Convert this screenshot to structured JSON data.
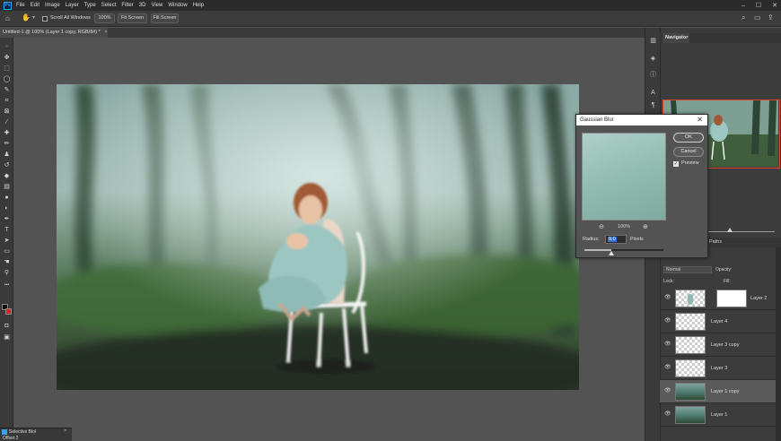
{
  "menu": {
    "items": [
      "File",
      "Edit",
      "Image",
      "Layer",
      "Type",
      "Select",
      "Filter",
      "3D",
      "View",
      "Window",
      "Help"
    ]
  },
  "options_bar": {
    "scroll_all_label": "Scroll All Windows",
    "zoom_value": "100%",
    "fit_screen_label": "Fit Screen",
    "fill_screen_label": "Fill Screen"
  },
  "document": {
    "tab_title": "Untitled-1 @ 100% (Layer 1 copy, RGB/8#) *"
  },
  "panels": {
    "navigator_tab": "Navigator",
    "layers_tab": "Paths",
    "blend_mode": "Normal",
    "opacity_label": "Opacity:",
    "lock_label": "Lock:",
    "fill_label": "Fill:"
  },
  "layers": [
    {
      "name": "Layer 2",
      "thumb": "person",
      "has_mask": true
    },
    {
      "name": "Layer 4",
      "thumb": "checker",
      "has_mask": false
    },
    {
      "name": "Layer 3 copy",
      "thumb": "checker",
      "has_mask": false
    },
    {
      "name": "Layer 3",
      "thumb": "checker",
      "has_mask": false
    },
    {
      "name": "Layer 1 copy",
      "thumb": "forest",
      "has_mask": false
    },
    {
      "name": "Layer 1",
      "thumb": "forest",
      "has_mask": false
    }
  ],
  "gaussian_blur": {
    "title": "Gaussian Blur",
    "ok_label": "OK",
    "cancel_label": "Cancel",
    "preview_label": "Preview",
    "preview_checked": true,
    "zoom_label": "100%",
    "radius_label": "Radius:",
    "radius_value": "9.0",
    "units_label": "Pixels",
    "radius_slider_fraction": 0.34
  },
  "bottom_panel": {
    "title": "Selective Biol",
    "subtitle": "Offset 2"
  },
  "colors": {
    "accent": "#2fa3f7",
    "foreground": "#111111",
    "background": "#e02020",
    "nav_frame": "#e0452f"
  }
}
